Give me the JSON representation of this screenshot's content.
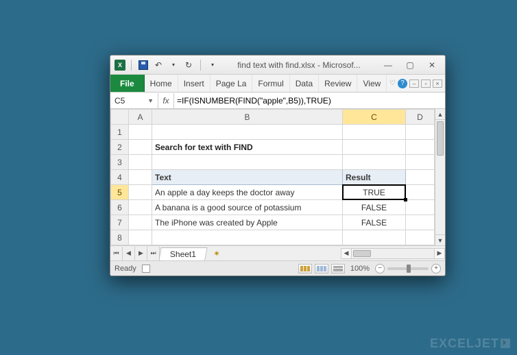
{
  "window": {
    "title": "find text with find.xlsx - Microsof..."
  },
  "ribbon": {
    "file": "File",
    "tabs": [
      "Home",
      "Insert",
      "Page La",
      "Formul",
      "Data",
      "Review",
      "View"
    ]
  },
  "namebox": "C5",
  "fx_label": "fx",
  "formula": "=IF(ISNUMBER(FIND(\"apple\",B5)),TRUE)",
  "columns": [
    "A",
    "B",
    "C",
    "D"
  ],
  "rows": [
    "1",
    "2",
    "3",
    "4",
    "5",
    "6",
    "7",
    "8"
  ],
  "cells": {
    "B2": "Search for text with FIND",
    "B4": "Text",
    "C4": "Result",
    "B5": "An apple a day keeps the doctor away",
    "C5": "TRUE",
    "B6": "A banana is a good source of potassium",
    "C6": "FALSE",
    "B7": "The iPhone was created by Apple",
    "C7": "FALSE"
  },
  "sheet_tab": "Sheet1",
  "status": {
    "ready": "Ready",
    "zoom": "100%"
  },
  "watermark": "EXCELJET"
}
